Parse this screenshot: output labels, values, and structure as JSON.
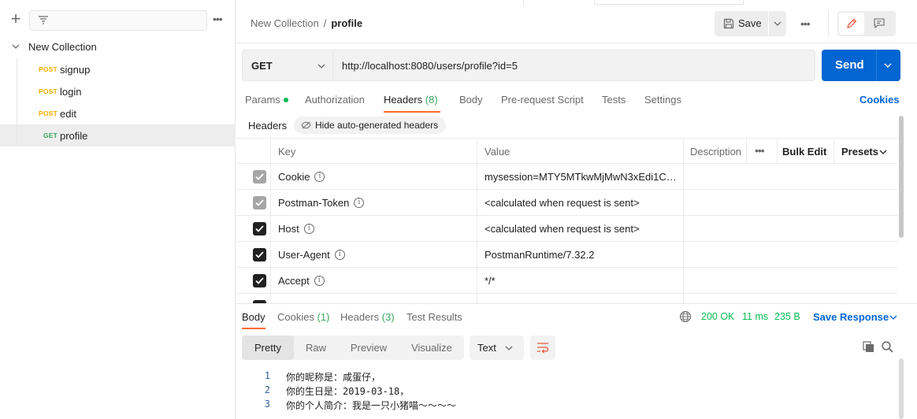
{
  "sidebar": {
    "collection_name": "New Collection",
    "items": [
      {
        "method": "POST",
        "name": "signup"
      },
      {
        "method": "POST",
        "name": "login"
      },
      {
        "method": "POST",
        "name": "edit"
      },
      {
        "method": "GET",
        "name": "profile"
      }
    ]
  },
  "header": {
    "breadcrumb_parent": "New Collection",
    "breadcrumb_sep": "/",
    "breadcrumb_current": "profile",
    "save_label": "Save"
  },
  "request": {
    "method": "GET",
    "url": "http://localhost:8080/users/profile?id=5",
    "send_label": "Send"
  },
  "request_tabs": {
    "params": "Params",
    "authorization": "Authorization",
    "headers": "Headers",
    "headers_count": "(8)",
    "body": "Body",
    "prerequest": "Pre-request Script",
    "tests": "Tests",
    "settings": "Settings",
    "cookies": "Cookies"
  },
  "headers_section": {
    "label": "Headers",
    "hide_auto": "Hide auto-generated headers",
    "columns": {
      "key": "Key",
      "value": "Value",
      "description": "Description",
      "bulk_edit": "Bulk Edit",
      "presets": "Presets"
    },
    "rows": [
      {
        "key": "Cookie",
        "value": "mysession=MTY5MTkwMjMwN3xEdi1CQ...",
        "state": "disabled"
      },
      {
        "key": "Postman-Token",
        "value": "<calculated when request is sent>",
        "state": "disabled"
      },
      {
        "key": "Host",
        "value": "<calculated when request is sent>",
        "state": "on"
      },
      {
        "key": "User-Agent",
        "value": "PostmanRuntime/7.32.2",
        "state": "on"
      },
      {
        "key": "Accept",
        "value": "*/*",
        "state": "on"
      }
    ]
  },
  "response": {
    "tabs": {
      "body": "Body",
      "cookies": "Cookies",
      "cookies_count": "(1)",
      "headers": "Headers",
      "headers_count": "(3)",
      "test_results": "Test Results"
    },
    "status": "200 OK",
    "time": "11 ms",
    "size": "235 B",
    "save_response": "Save Response",
    "views": [
      "Pretty",
      "Raw",
      "Preview",
      "Visualize"
    ],
    "format": "Text",
    "lines": [
      {
        "n": "1",
        "text": "你的昵称是：咸蛋仔，"
      },
      {
        "n": "2",
        "text": "你的生日是：2019-03-18，"
      },
      {
        "n": "3",
        "text": "你的个人简介：我是一只小猪喵～～～～"
      }
    ]
  }
}
